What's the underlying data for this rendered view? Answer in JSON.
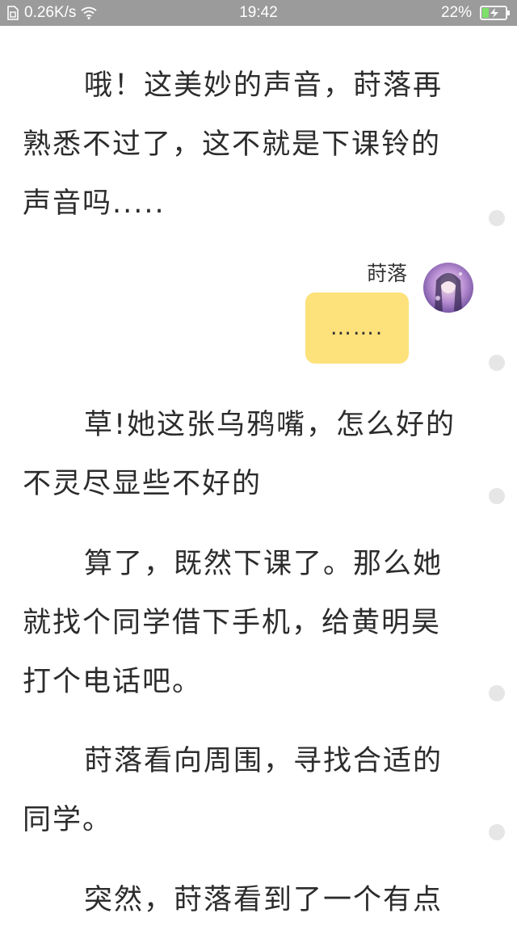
{
  "status_bar": {
    "network_speed": "0.26K/s",
    "time": "19:42",
    "battery_percent": "22%",
    "icons": [
      "sim-icon",
      "wifi-icon",
      "battery-charging-icon"
    ]
  },
  "paragraphs": [
    "哦！这美妙的声音，莳落再熟悉不过了，这不就是下课铃的声音吗.....",
    "草!她这张乌鸦嘴，怎么好的不灵尽显些不好的",
    "算了，既然下课了。那么她就找个同学借下手机，给黄明昊打个电话吧。",
    "莳落看向周围，寻找合适的同学。",
    "突然，莳落看到了一个有点"
  ],
  "dialog": {
    "speaker": "莳落",
    "message": "……."
  },
  "colors": {
    "status_bar_bg": "#9b9b9b",
    "bubble": "#fde17a",
    "side_dot": "#e6e6e6",
    "text": "#2c2c2c"
  }
}
